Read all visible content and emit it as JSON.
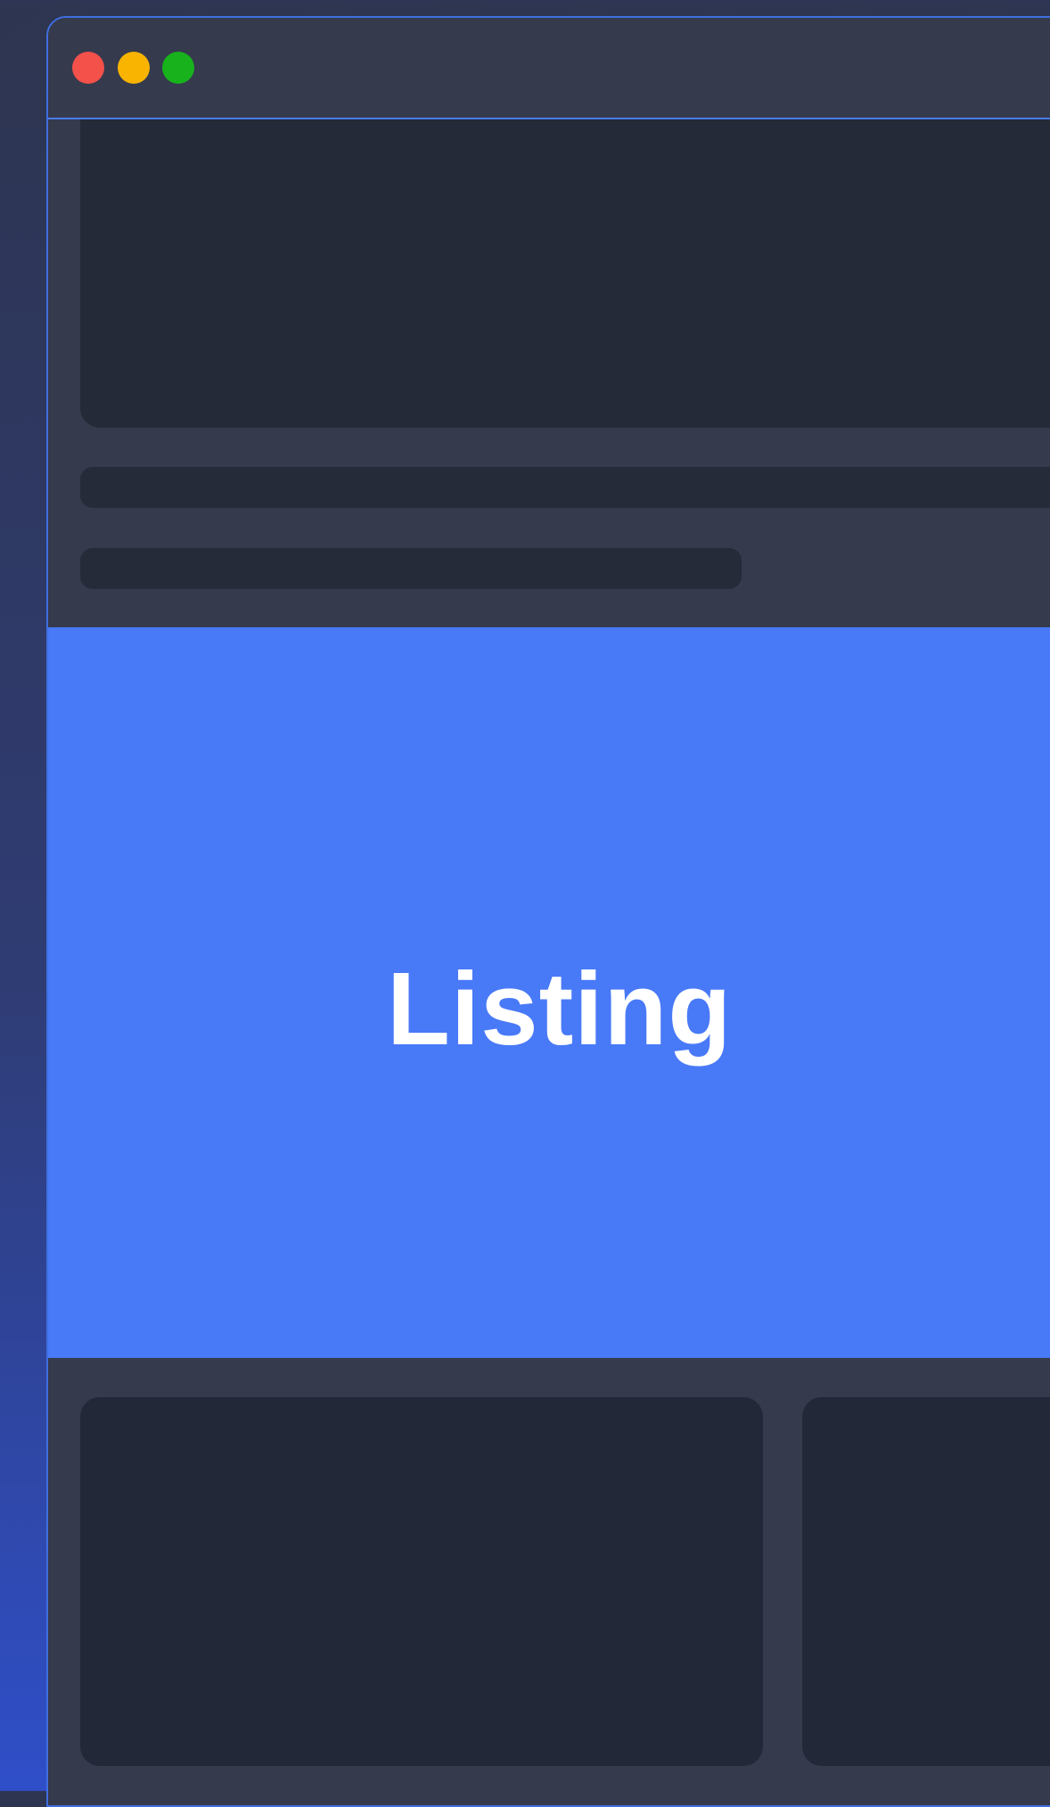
{
  "window": {
    "title_buttons": [
      "close-dot",
      "minimize-dot",
      "maximize-dot"
    ]
  },
  "hero": {
    "placeholder": "",
    "lines": [
      "",
      ""
    ]
  },
  "listing": {
    "title": "Listing"
  },
  "cards": [
    {
      "placeholder": ""
    },
    {
      "placeholder": ""
    }
  ],
  "colors": {
    "accent": "#4879f7",
    "close": "#f4514a",
    "minimize": "#f8b400",
    "maximize": "#17b21c"
  }
}
